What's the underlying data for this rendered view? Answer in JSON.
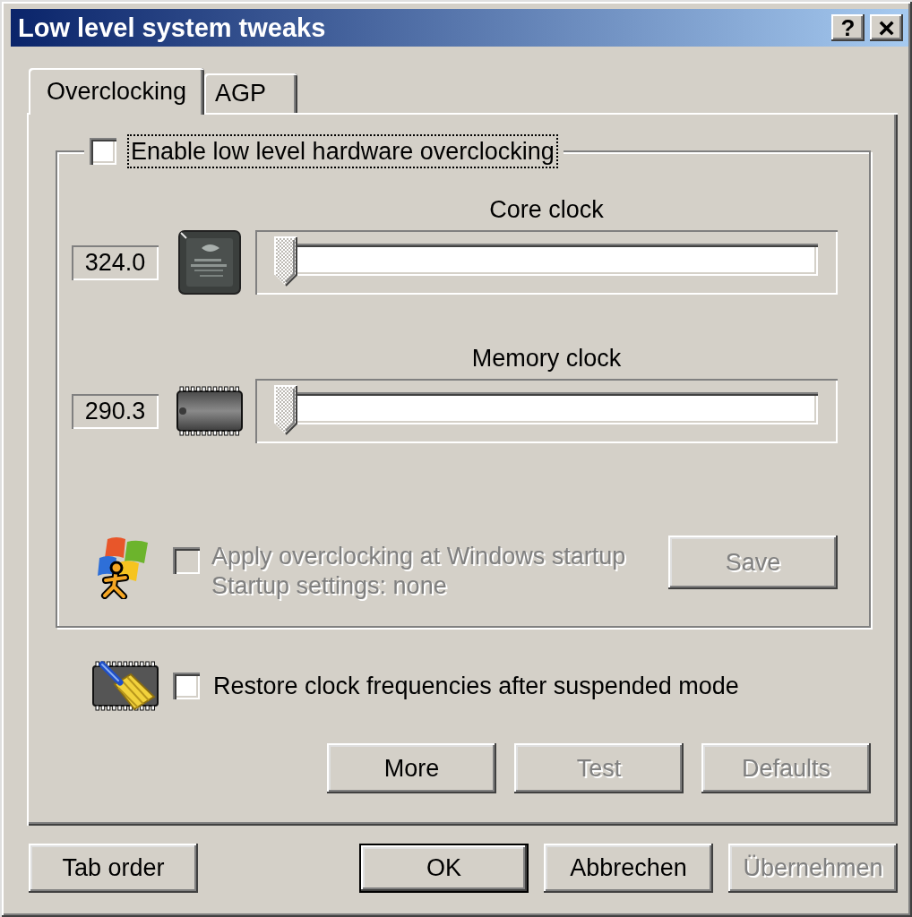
{
  "window": {
    "title": "Low level system tweaks",
    "help_button": "?",
    "close_button": "×"
  },
  "tabs": [
    {
      "label": "Overclocking",
      "selected": true
    },
    {
      "label": "AGP",
      "selected": false
    }
  ],
  "overclocking_group": {
    "enable_checkbox": {
      "label": "Enable low level hardware overclocking",
      "checked": false,
      "disabled": false,
      "focused": true
    },
    "clocks": [
      {
        "kind": "core",
        "label": "Core clock",
        "value": "324.0",
        "slider": {
          "level": 0,
          "disabled": true
        }
      },
      {
        "kind": "memory",
        "label": "Memory clock",
        "value": "290.3",
        "slider": {
          "level": 0,
          "disabled": true
        }
      }
    ],
    "startup_checkbox": {
      "label": "Apply overclocking at Windows startup",
      "checked": false,
      "disabled": true
    },
    "startup_settings": "Startup settings: none",
    "save_button": {
      "label": "Save",
      "disabled": true
    }
  },
  "restore_checkbox": {
    "label": "Restore clock frequencies after suspended mode",
    "checked": false,
    "disabled": false
  },
  "panel_buttons": [
    {
      "label": "More",
      "disabled": false
    },
    {
      "label": "Test",
      "disabled": true
    },
    {
      "label": "Defaults",
      "disabled": true
    }
  ],
  "tab_order_button": {
    "label": "Tab order",
    "disabled": false,
    "default": false
  },
  "dialog_buttons": [
    {
      "label": "OK",
      "disabled": false,
      "default": true
    },
    {
      "label": "Abbrechen",
      "disabled": false,
      "default": false
    },
    {
      "label": "Übernehmen",
      "disabled": true,
      "default": false
    }
  ]
}
